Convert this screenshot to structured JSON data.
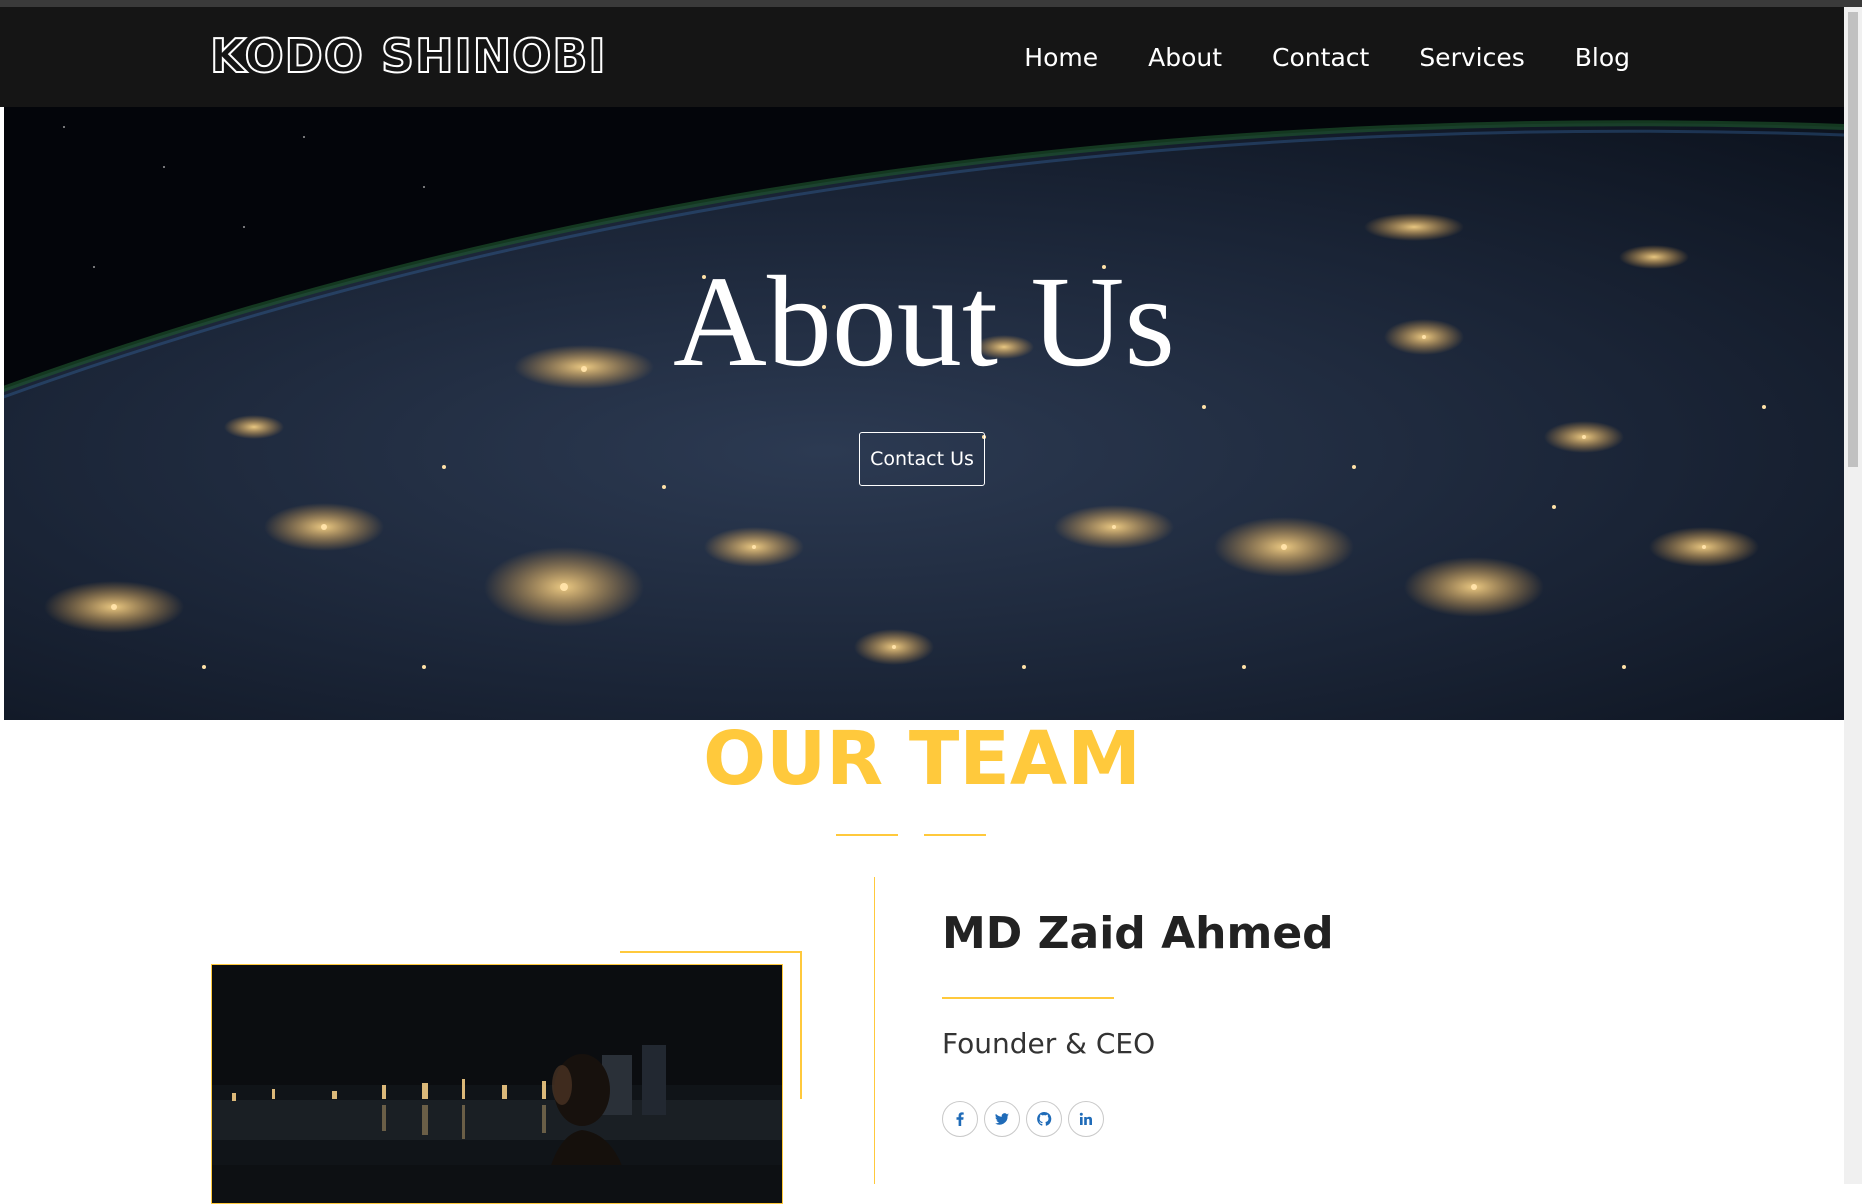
{
  "brand": {
    "logo_text": "KODO SHINOBI"
  },
  "nav": {
    "items": [
      "Home",
      "About",
      "Contact",
      "Services",
      "Blog"
    ]
  },
  "hero": {
    "title": "About Us",
    "button_label": "Contact Us"
  },
  "team": {
    "heading": "OUR TEAM",
    "member": {
      "name": "MD Zaid Ahmed",
      "role": "Founder & CEO",
      "socials": [
        "facebook-icon",
        "twitter-icon",
        "github-icon",
        "linkedin-icon"
      ]
    }
  },
  "colors": {
    "accent": "#ffc93c",
    "nav_bg": "#151515",
    "social_icon": "#1f6bb8"
  }
}
